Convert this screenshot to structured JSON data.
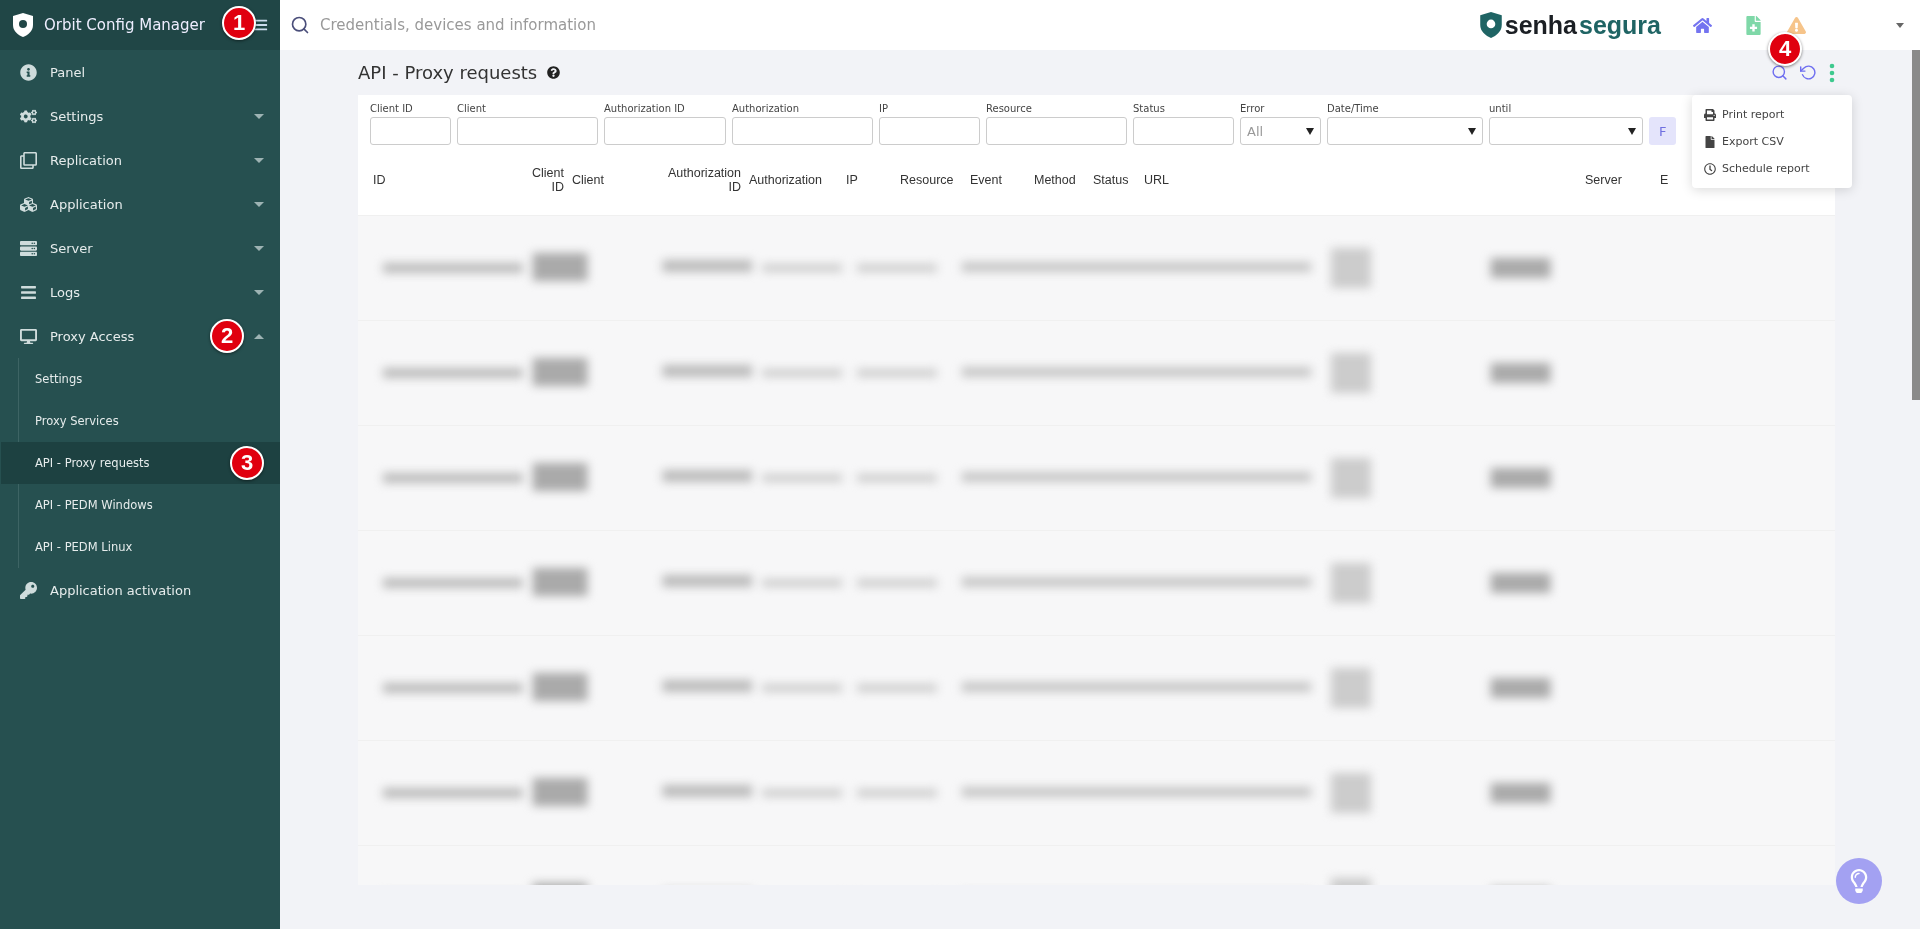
{
  "brand": {
    "title": "Orbit Config Manager",
    "badge": "1"
  },
  "search": {
    "placeholder": "Credentials, devices and information"
  },
  "logo": {
    "part_1": "senha",
    "part_2": "segura"
  },
  "sidebar": {
    "items": [
      {
        "label": "Panel"
      },
      {
        "label": "Settings",
        "expanded": false
      },
      {
        "label": "Replication",
        "expanded": false
      },
      {
        "label": "Application",
        "expanded": false
      },
      {
        "label": "Server",
        "expanded": false
      },
      {
        "label": "Logs",
        "expanded": false
      },
      {
        "label": "Proxy Access",
        "expanded": true,
        "badge": "2",
        "children": [
          {
            "label": "Settings",
            "selected": false
          },
          {
            "label": "Proxy Services",
            "selected": false
          },
          {
            "label": "API - Proxy requests",
            "selected": true,
            "badge": "3"
          },
          {
            "label": "API - PEDM Windows",
            "selected": false
          },
          {
            "label": "API - PEDM Linux",
            "selected": false
          }
        ]
      },
      {
        "label": "Application activation"
      }
    ]
  },
  "page": {
    "title": "API - Proxy requests",
    "menu_badge": "4"
  },
  "filters": [
    {
      "label": "Client ID",
      "kind": "text"
    },
    {
      "label": "Client",
      "kind": "text"
    },
    {
      "label": "Authorization ID",
      "kind": "text"
    },
    {
      "label": "Authorization",
      "kind": "text"
    },
    {
      "label": "IP",
      "kind": "text"
    },
    {
      "label": "Resource",
      "kind": "text"
    },
    {
      "label": "Status",
      "kind": "text"
    },
    {
      "label": "Error",
      "kind": "select",
      "value": "All"
    },
    {
      "label": "Date/Time",
      "kind": "select"
    },
    {
      "label": "until",
      "kind": "select"
    }
  ],
  "filter_button": "F",
  "table": {
    "columns": [
      "ID",
      "Client ID",
      "Client",
      "Authorization ID",
      "Authorization",
      "IP",
      "Resource",
      "Event",
      "Method",
      "Status",
      "URL",
      "Server",
      "E"
    ],
    "rows": [
      {
        "kind": "blurred"
      },
      {
        "kind": "blurred"
      },
      {
        "kind": "blurred"
      },
      {
        "kind": "blurred"
      },
      {
        "kind": "blurred"
      },
      {
        "kind": "blurred"
      },
      {
        "kind": "blurred"
      }
    ]
  },
  "menu": {
    "items": [
      {
        "label": "Print report"
      },
      {
        "label": "Export CSV"
      },
      {
        "label": "Schedule report"
      }
    ]
  }
}
